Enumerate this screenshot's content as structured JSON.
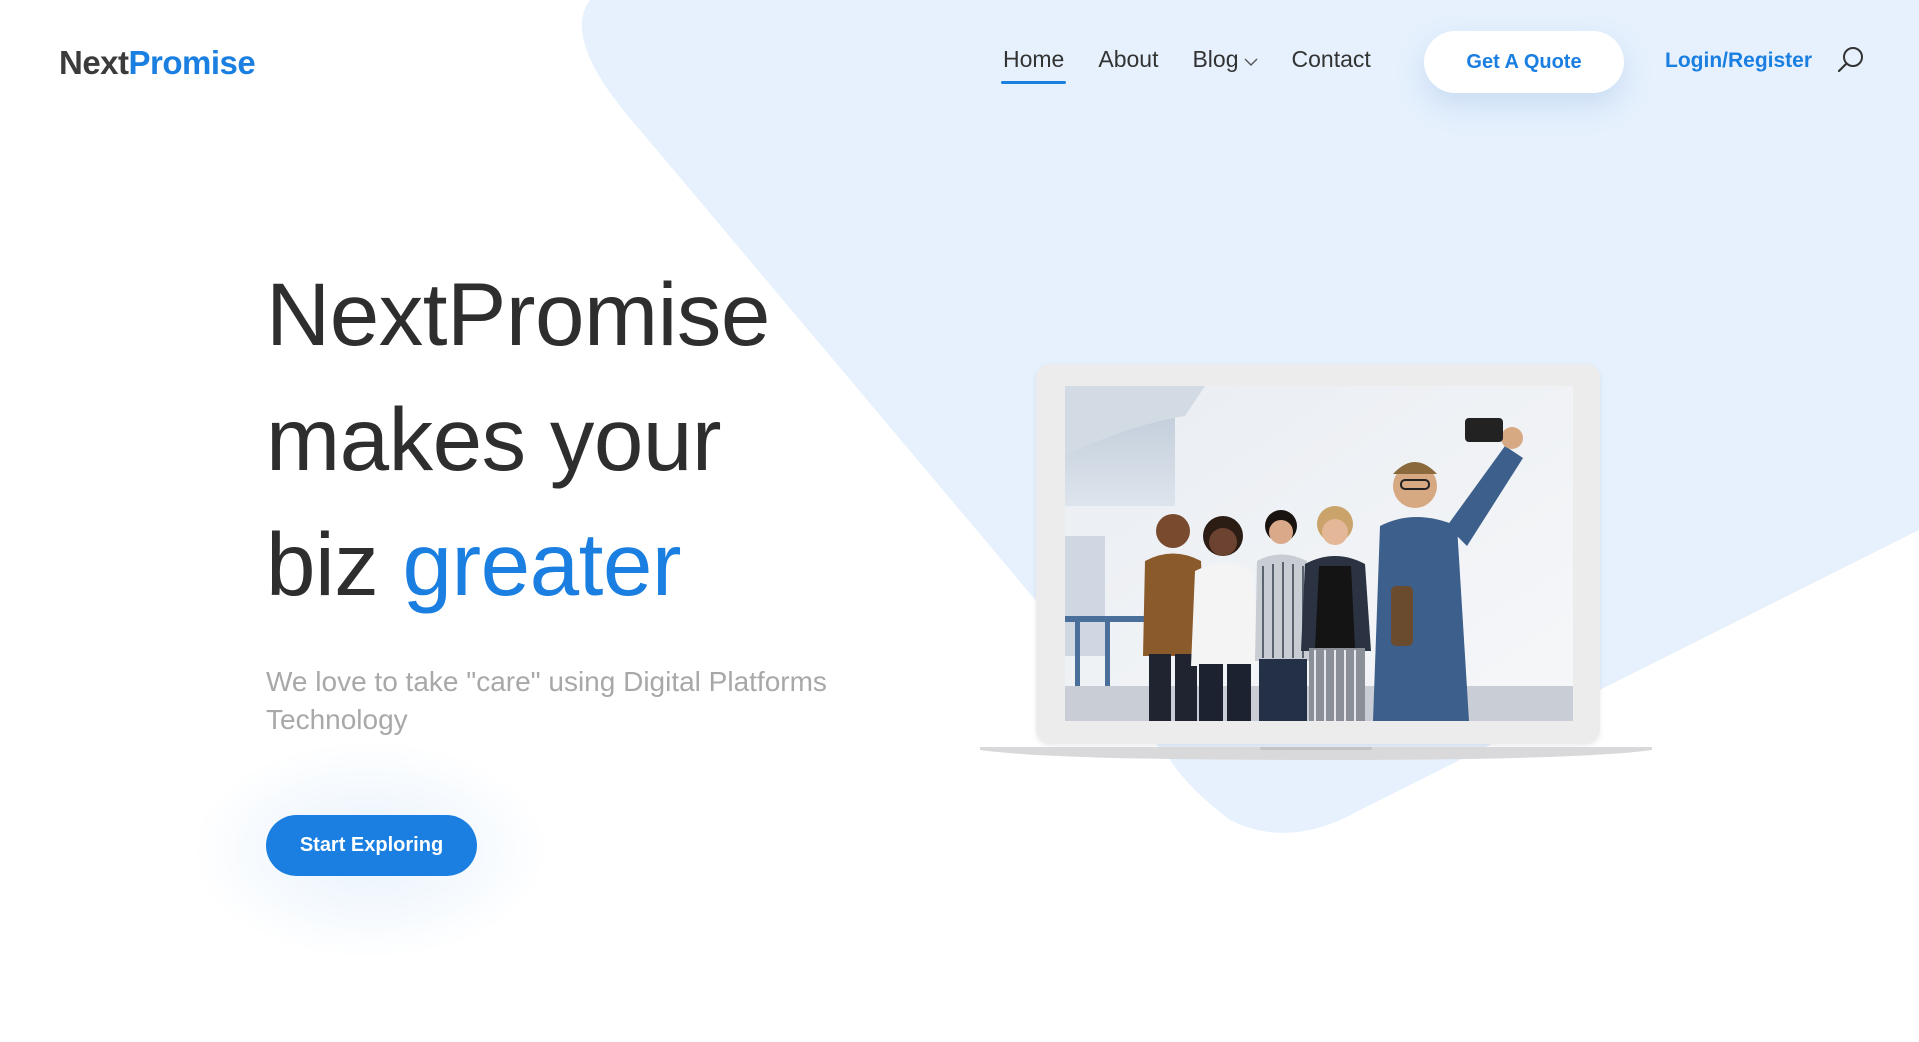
{
  "brand": {
    "name_part1": "Next",
    "name_part2": "Promise"
  },
  "nav": {
    "items": [
      {
        "label": "Home",
        "active": true
      },
      {
        "label": "About",
        "active": false
      },
      {
        "label": "Blog",
        "active": false,
        "has_dropdown": true
      },
      {
        "label": "Contact",
        "active": false
      }
    ],
    "quote_button": "Get A Quote",
    "login_link": "Login/Register",
    "search_icon": "search-icon"
  },
  "hero": {
    "title_line1": "NextPromise",
    "title_line2": "makes your",
    "title_line3_plain": "biz ",
    "title_line3_accent": "greater",
    "subtitle": "We love to take \"care\" using Digital Platforms Technology",
    "cta_label": "Start Exploring"
  },
  "hero_image": {
    "description_icon": "laptop-photo-group-selfie"
  },
  "colors": {
    "accent": "#1a7fe0",
    "text_dark": "#2e2e2e",
    "text_muted": "#a8a8a8",
    "bg_shape": "#e6f1fd"
  }
}
